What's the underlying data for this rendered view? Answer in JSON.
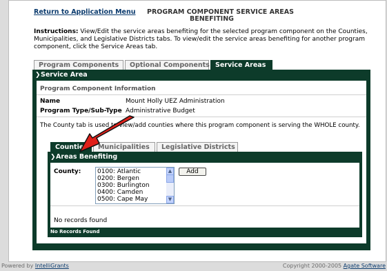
{
  "header": {
    "return_link": "Return to Application Menu",
    "title_line1": "PROGRAM COMPONENT SERVICE AREAS",
    "title_line2": "BENEFITING"
  },
  "instructions": {
    "label": "Instructions:",
    "text": " View/Edit the service areas benefiting for the selected program component on the Counties, Municipalities, and Legislative Districts tabs. To view/edit the service areas benefiting for another program component, click the Service Areas tab."
  },
  "tabs": [
    {
      "label": "Program Components",
      "active": false
    },
    {
      "label": "Optional Components",
      "active": false
    },
    {
      "label": "Service Areas",
      "active": true
    }
  ],
  "service_area": {
    "header": "Service Area",
    "info_heading": "Program Component Information",
    "name_label": "Name",
    "name_value": "Mount Holly UEZ Administration",
    "type_label": "Program Type/Sub-Type",
    "type_value": "Administrative Budget",
    "note": "The County tab is used to view/add counties where this program component is serving the WHOLE county."
  },
  "sub_tabs": [
    {
      "label": "Counties",
      "active": true
    },
    {
      "label": "Municipalities",
      "active": false
    },
    {
      "label": "Legislative Districts",
      "active": false
    }
  ],
  "areas": {
    "header": "Areas Benefiting",
    "county_label": "County:",
    "county_options": [
      "0100: Atlantic",
      "0200: Bergen",
      "0300: Burlington",
      "0400: Camden",
      "0500: Cape May"
    ],
    "add_button": "Add",
    "no_records": "No records found",
    "no_records_bar": "No Records Found"
  },
  "footer": {
    "prefix": "Powered by ",
    "link": "IntelliGrants",
    "copyright": "Copyright 2000-2005 ",
    "company": "Agate Software"
  },
  "colors": {
    "panel": "#0d3b2a",
    "annotation_arrow": "#e0201a"
  }
}
